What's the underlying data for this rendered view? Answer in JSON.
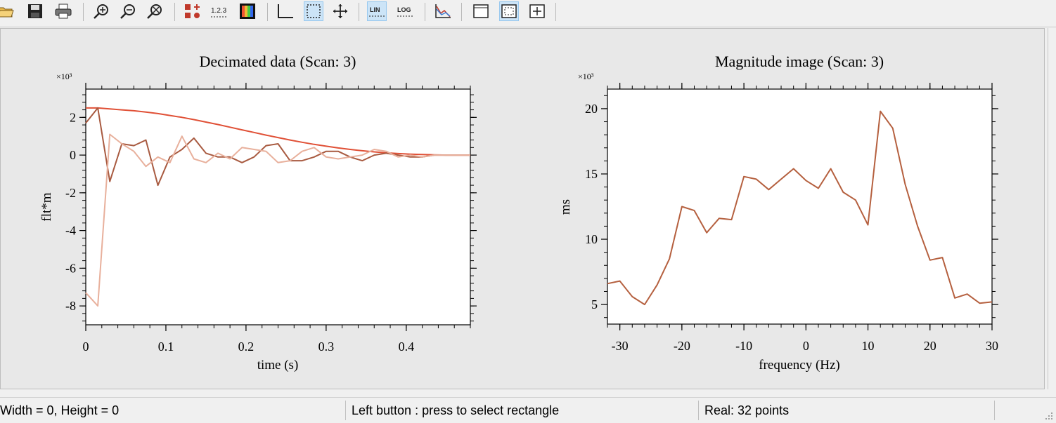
{
  "toolbar": {
    "buttons": [
      {
        "icon": "open-folder-icon"
      },
      {
        "icon": "save-icon"
      },
      {
        "icon": "print-icon"
      },
      {
        "icon": "zoom-in-icon"
      },
      {
        "icon": "zoom-out-icon"
      },
      {
        "icon": "zoom-reset-icon"
      },
      {
        "icon": "markers-icon"
      },
      {
        "icon": "number-format-icon",
        "label": "1.2.3"
      },
      {
        "icon": "colormap-icon"
      },
      {
        "icon": "axes-icon"
      },
      {
        "icon": "select-rectangle-icon",
        "active": true
      },
      {
        "icon": "pan-icon"
      },
      {
        "icon": "linear-scale-icon",
        "label": "LIN",
        "active": true
      },
      {
        "icon": "log-scale-icon",
        "label": "LOG"
      },
      {
        "icon": "spectrum-icon"
      },
      {
        "icon": "frame-icon"
      },
      {
        "icon": "frame-fill-icon",
        "active": true
      },
      {
        "icon": "frame-move-icon"
      }
    ]
  },
  "chart_data": [
    {
      "type": "line",
      "title": "Decimated data (Scan: 3)",
      "xlabel": "time (s)",
      "ylabel": "flt*m",
      "multiplier": "×10³",
      "xlim": [
        0,
        0.48
      ],
      "ylim": [
        -9,
        3.5
      ],
      "xticks": [
        0,
        0.1,
        0.2,
        0.3,
        0.4
      ],
      "xticklabels": [
        "0",
        "0.1",
        "0.2",
        "0.3",
        "0.4"
      ],
      "yticks": [
        2,
        0,
        -2,
        -4,
        -6,
        -8
      ],
      "yticklabels": [
        "2",
        "0",
        "-2",
        "-4",
        "-6",
        "-8"
      ],
      "grid": false,
      "series": [
        {
          "color": "#e05036",
          "x": [
            0,
            0.015,
            0.03,
            0.045,
            0.06,
            0.075,
            0.09,
            0.105,
            0.12,
            0.135,
            0.15,
            0.165,
            0.18,
            0.195,
            0.21,
            0.225,
            0.24,
            0.255,
            0.27,
            0.285,
            0.3,
            0.315,
            0.33,
            0.345,
            0.36,
            0.375,
            0.39,
            0.405,
            0.42,
            0.435,
            0.45,
            0.48
          ],
          "values": [
            2.5,
            2.5,
            2.45,
            2.4,
            2.35,
            2.28,
            2.2,
            2.1,
            2.0,
            1.88,
            1.75,
            1.62,
            1.48,
            1.34,
            1.2,
            1.06,
            0.93,
            0.8,
            0.68,
            0.57,
            0.47,
            0.38,
            0.3,
            0.23,
            0.17,
            0.12,
            0.08,
            0.05,
            0.03,
            0.01,
            0.0,
            0.0
          ]
        },
        {
          "color": "#a85a40",
          "x": [
            0,
            0.015,
            0.03,
            0.045,
            0.06,
            0.075,
            0.09,
            0.105,
            0.12,
            0.135,
            0.15,
            0.165,
            0.18,
            0.195,
            0.21,
            0.225,
            0.24,
            0.255,
            0.27,
            0.285,
            0.3,
            0.315,
            0.33,
            0.345,
            0.36,
            0.375,
            0.39,
            0.405,
            0.42,
            0.435,
            0.45,
            0.48
          ],
          "values": [
            1.7,
            2.5,
            -1.4,
            0.6,
            0.5,
            0.8,
            -1.6,
            -0.1,
            0.3,
            0.9,
            0.1,
            -0.1,
            -0.1,
            -0.4,
            -0.1,
            0.5,
            0.6,
            -0.3,
            -0.3,
            -0.1,
            0.2,
            0.2,
            -0.1,
            -0.3,
            0.0,
            0.1,
            0.0,
            -0.1,
            -0.1,
            0.0,
            0.0,
            0.0
          ]
        },
        {
          "color": "#e8b09c",
          "x": [
            0,
            0.015,
            0.03,
            0.045,
            0.06,
            0.075,
            0.09,
            0.105,
            0.12,
            0.135,
            0.15,
            0.165,
            0.18,
            0.195,
            0.21,
            0.225,
            0.24,
            0.255,
            0.27,
            0.285,
            0.3,
            0.315,
            0.33,
            0.345,
            0.36,
            0.375,
            0.39,
            0.405,
            0.42,
            0.435,
            0.45,
            0.48
          ],
          "values": [
            -7.3,
            -8.0,
            1.1,
            0.6,
            0.2,
            -0.6,
            -0.1,
            -0.4,
            1.0,
            -0.2,
            -0.4,
            0.1,
            -0.2,
            0.4,
            0.3,
            0.2,
            -0.4,
            -0.3,
            0.2,
            0.4,
            -0.1,
            -0.2,
            -0.1,
            0.0,
            0.3,
            0.2,
            -0.1,
            0.0,
            -0.1,
            0.0,
            0.0,
            0.0
          ]
        }
      ]
    },
    {
      "type": "line",
      "title": "Magnitude image (Scan: 3)",
      "xlabel": "frequency (Hz)",
      "ylabel": "ms",
      "multiplier": "×10³",
      "xlim": [
        -32,
        30
      ],
      "ylim": [
        3.5,
        21.5
      ],
      "xticks": [
        -30,
        -20,
        -10,
        0,
        10,
        20,
        30
      ],
      "xticklabels": [
        "-30",
        "-20",
        "-10",
        "0",
        "10",
        "20",
        "30"
      ],
      "yticks": [
        20,
        15,
        10,
        5
      ],
      "yticklabels": [
        "20",
        "15",
        "10",
        "5"
      ],
      "grid": false,
      "series": [
        {
          "color": "#b5603f",
          "x": [
            -32,
            -30,
            -28,
            -26,
            -24,
            -22,
            -20,
            -18,
            -16,
            -14,
            -12,
            -10,
            -8,
            -6,
            -4,
            -2,
            0,
            2,
            4,
            6,
            8,
            10,
            12,
            14,
            16,
            18,
            20,
            22,
            24,
            26,
            28,
            30
          ],
          "values": [
            6.6,
            6.8,
            5.6,
            5.0,
            6.5,
            8.5,
            12.5,
            12.2,
            10.5,
            11.6,
            11.5,
            14.8,
            14.6,
            13.8,
            14.6,
            15.4,
            14.5,
            13.9,
            15.4,
            13.6,
            13.0,
            11.1,
            19.8,
            18.5,
            14.2,
            11.0,
            8.4,
            8.6,
            5.5,
            5.8,
            5.1,
            5.2
          ]
        }
      ]
    }
  ],
  "status": {
    "size": "Width =  0, Height =  0",
    "hint": "Left button : press to select rectangle",
    "points": "Real: 32 points",
    "extra": ""
  }
}
